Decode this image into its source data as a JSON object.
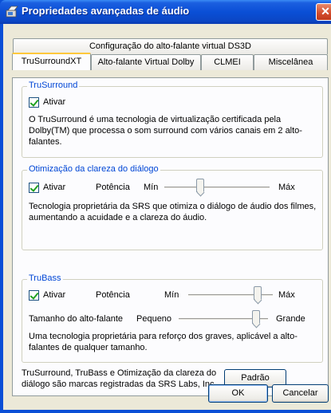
{
  "window": {
    "title": "Propriedades avançadas de áudio",
    "close_glyph": "✕"
  },
  "tabs": {
    "top_row": [
      "Configuração do alto-falante virtual DS3D"
    ],
    "bottom_row": [
      "TruSurroundXT",
      "Alto-falante Virtual Dolby",
      "CLMEI",
      "Miscelânea"
    ],
    "active": "TruSurroundXT"
  },
  "trusurround": {
    "title": "TruSurround",
    "checkbox_label": "Ativar",
    "checked": true,
    "description": "O TruSurround é uma tecnologia de virtualização certificada pela Dolby(TM) que processa o som surround com vários canais em 2 alto-falantes."
  },
  "dialog_clarity": {
    "title": "Otimização da clareza do diálogo",
    "checkbox_label": "Ativar",
    "checked": true,
    "power_label": "Potência",
    "min_label": "Mín",
    "max_label": "Máx",
    "slider_level": 0.33,
    "description": "Tecnologia proprietária da SRS que otimiza o diálogo de áudio dos filmes, aumentando a acuidade e a clareza do áudio."
  },
  "trubass": {
    "title": "TruBass",
    "checkbox_label": "Ativar",
    "checked": true,
    "power_label": "Potência",
    "min_label": "Mín",
    "max_label": "Máx",
    "power_level": 0.85,
    "speaker_size_label": "Tamanho do alto-falante",
    "small_label": "Pequeno",
    "large_label": "Grande",
    "speaker_size_level": 0.9,
    "description": "Uma tecnologia proprietária para reforço dos graves, aplicável a alto-falantes de qualquer tamanho."
  },
  "footer": {
    "trademark_text": "TruSurround, TruBass e Otimização da clareza do diálogo são marcas registradas da SRS Labs, Inc.",
    "default_button": "Padrão"
  },
  "buttons": {
    "ok": "OK",
    "cancel": "Cancelar"
  },
  "colors": {
    "titlebar": "#0a4fd6",
    "group_title": "#0046d5",
    "dialog_bg": "#ece9d8",
    "active_tab_accent": "#ffc83c"
  }
}
